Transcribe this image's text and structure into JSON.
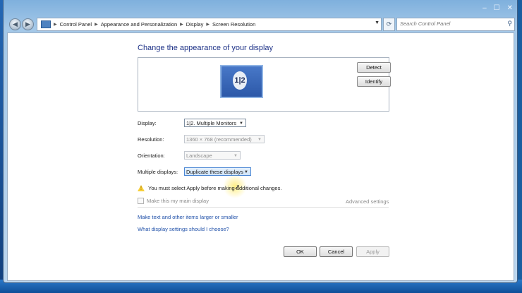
{
  "titlebar": {
    "minimize": "–",
    "maximize": "☐",
    "close": "✕"
  },
  "address": {
    "back": "◀",
    "forward": "▶",
    "crumbs": [
      "Control Panel",
      "Appearance and Personalization",
      "Display",
      "Screen Resolution"
    ],
    "search_placeholder": "Search Control Panel"
  },
  "page": {
    "heading": "Change the appearance of your display"
  },
  "monitor": {
    "number": "1|2",
    "detect": "Detect",
    "identify": "Identify"
  },
  "settings": {
    "display_label": "Display:",
    "display_value": "1|2. Multiple Monitors",
    "resolution_label": "Resolution:",
    "resolution_value": "1360 × 768 (recommended)",
    "orientation_label": "Orientation:",
    "orientation_value": "Landscape",
    "multiple_label": "Multiple displays:",
    "multiple_value": "Duplicate these displays"
  },
  "warning": "You must select Apply before making additional changes.",
  "main_display": "Make this my main display",
  "advanced": "Advanced settings",
  "links": {
    "text_size": "Make text and other items larger or smaller",
    "which_settings": "What display settings should I choose?"
  },
  "buttons": {
    "ok": "OK",
    "cancel": "Cancel",
    "apply": "Apply"
  }
}
